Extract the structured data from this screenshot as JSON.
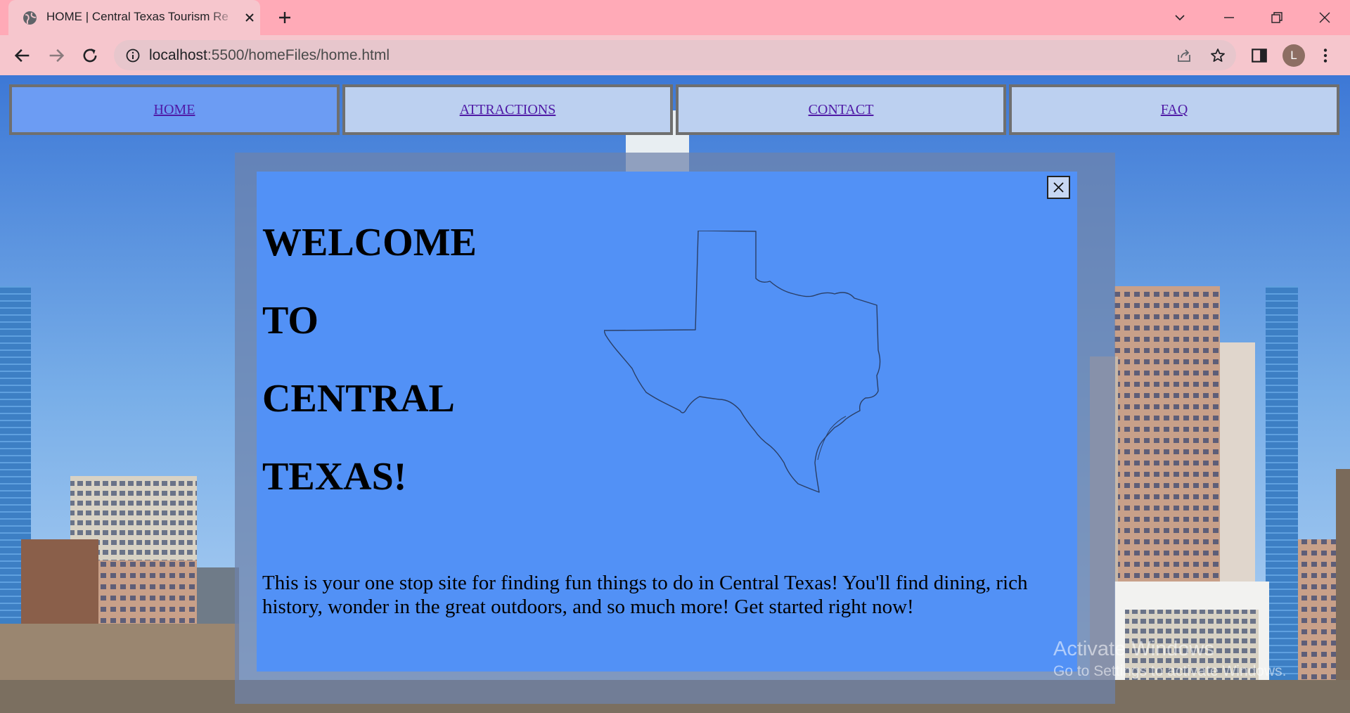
{
  "browser": {
    "tab": {
      "title": "HOME | Central Texas Tourism Re",
      "favicon": "globe-icon"
    },
    "address": {
      "host": "localhost",
      "path": ":5500/homeFiles/home.html"
    },
    "profile_initial": "L",
    "colors": {
      "tabstrip": "#ffaab7",
      "toolbar": "#f6c6cd",
      "omnibox": "#e7c6cc"
    }
  },
  "nav": {
    "items": [
      {
        "label": "HOME",
        "active": true
      },
      {
        "label": "ATTRACTIONS",
        "active": false
      },
      {
        "label": "CONTACT",
        "active": false
      },
      {
        "label": "FAQ",
        "active": false
      }
    ]
  },
  "modal": {
    "heading_lines": [
      "WELCOME",
      "TO",
      "CENTRAL",
      "TEXAS!"
    ],
    "intro": "This is your one stop site for finding fun things to do in Central Texas! You'll find dining, rich history, wonder in the great outdoors, and so much more! Get started right now!",
    "close_icon": "close-icon",
    "image": "texas-outline-map",
    "colors": {
      "background": "#5291f6"
    }
  },
  "watermark": {
    "title": "Activate Windows",
    "subtitle": "Go to Settings to activate Windows."
  }
}
